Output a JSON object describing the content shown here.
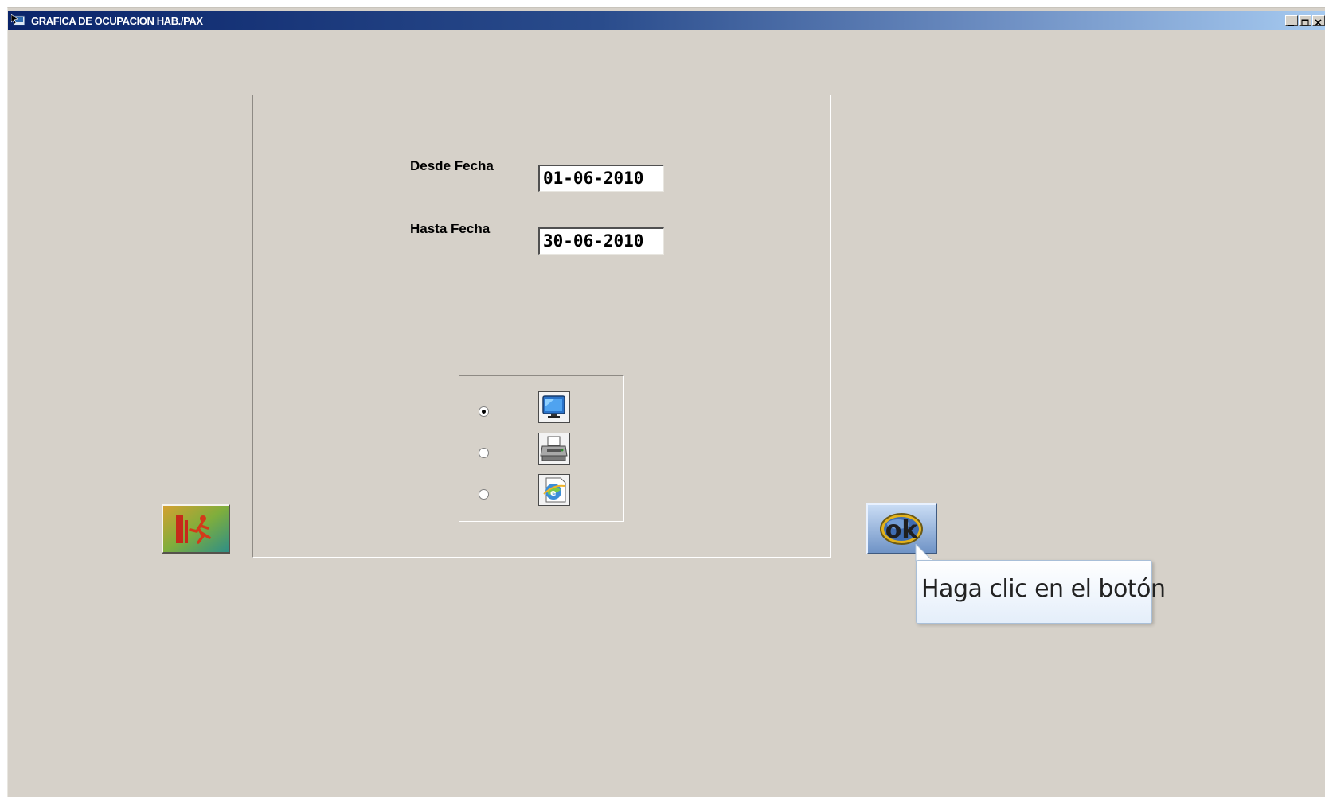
{
  "window": {
    "title": "GRAFICA DE OCUPACION HAB./PAX",
    "icon": "app-icon",
    "controls": [
      "minimize-icon",
      "maximize-icon",
      "close-icon"
    ]
  },
  "form": {
    "desde_label": "Desde Fecha",
    "desde_value": "01-06-2010",
    "hasta_label": "Hasta Fecha",
    "hasta_value": "30-06-2010"
  },
  "output_options": {
    "items": [
      {
        "icon": "monitor-screen-icon",
        "selected": true
      },
      {
        "icon": "printer-icon",
        "selected": false
      },
      {
        "icon": "internet-explorer-icon",
        "selected": false
      }
    ]
  },
  "buttons": {
    "exit_icon": "exit-door-running-man-icon",
    "ok_label": "ok"
  },
  "tooltip": {
    "text": "Haga clic en el botón"
  },
  "colors": {
    "window_bg": "#d6d1c9",
    "titlebar_start": "#0a246a",
    "titlebar_end": "#a6caf0",
    "tooltip_bg": "#eaf2fc",
    "ok_button": "#7fa0cc"
  }
}
